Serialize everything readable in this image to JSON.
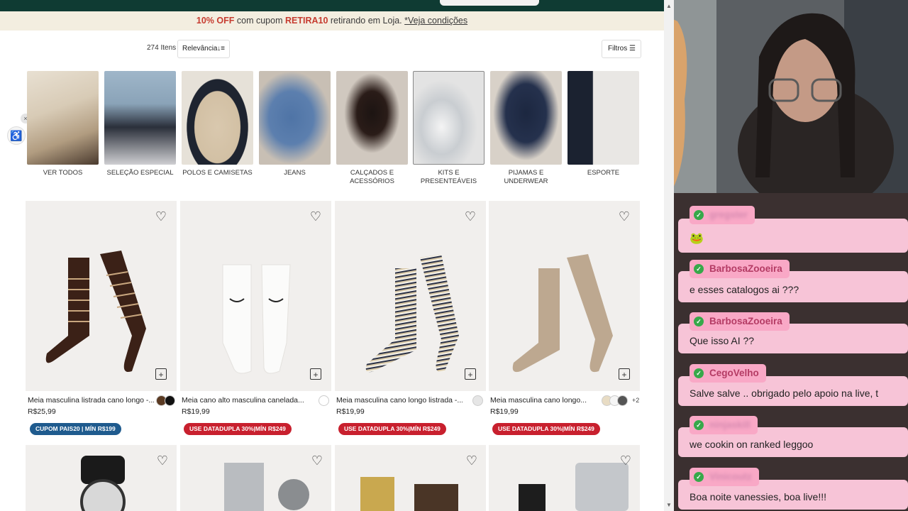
{
  "promo": {
    "discount": "10% OFF",
    "text1": "com cupom",
    "coupon": "RETIRA10",
    "text2": "retirando em Loja.",
    "link": "*Veja condições"
  },
  "toolbar": {
    "count": "274 Itens",
    "sort_label": "Relevância",
    "sort_icon": "↓≡",
    "filters_label": "Filtros",
    "filters_icon": "☰"
  },
  "categories": [
    {
      "label": "VER TODOS"
    },
    {
      "label": "SELEÇÃO ESPECIAL"
    },
    {
      "label": "POLOS E CAMISETAS"
    },
    {
      "label": "JEANS"
    },
    {
      "label": "CALÇADOS E ACESSÓRIOS"
    },
    {
      "label": "KITS E PRESENTEÁVEIS"
    },
    {
      "label": "PIJAMAS E UNDERWEAR"
    },
    {
      "label": "ESPORTE"
    }
  ],
  "products": [
    {
      "name": "Meia masculina listrada cano longo -...",
      "price": "R$25,99",
      "badge": "CUPOM PAIS20 | MÍN R$199"
    },
    {
      "name": "Meia cano alto masculina canelada...",
      "price": "R$19,99",
      "badge": "USE DATADUPLA 30%|MÍN R$249"
    },
    {
      "name": "Meia masculina cano longo listrada -...",
      "price": "R$19,99",
      "badge": "USE DATADUPLA 30%|MÍN R$249"
    },
    {
      "name": "Meia masculina cano longo...",
      "price": "R$19,99",
      "badge": "USE DATADUPLA 30%|MÍN R$249",
      "more": "+2"
    }
  ],
  "icons": {
    "heart": "♡",
    "bag": "+",
    "accessibility": "♿",
    "close": "×",
    "check": "✓",
    "scroll_up": "▲",
    "scroll_down": "▼"
  },
  "chat": [
    {
      "user": "gregster",
      "text": ""
    },
    {
      "user": "BarbosaZooeira",
      "text": "e esses catalogos ai ???"
    },
    {
      "user": "BarbosaZooeira",
      "text": "Que isso AI ??"
    },
    {
      "user": "CegoVelho",
      "text": "Salve salve .. obrigado pelo apoio na live, t"
    },
    {
      "user": "ninjaskill",
      "text": "we cookin on ranked leggoo"
    },
    {
      "user": "Vinicoutz",
      "text": "Boa noite vanessies, boa live!!!"
    }
  ]
}
